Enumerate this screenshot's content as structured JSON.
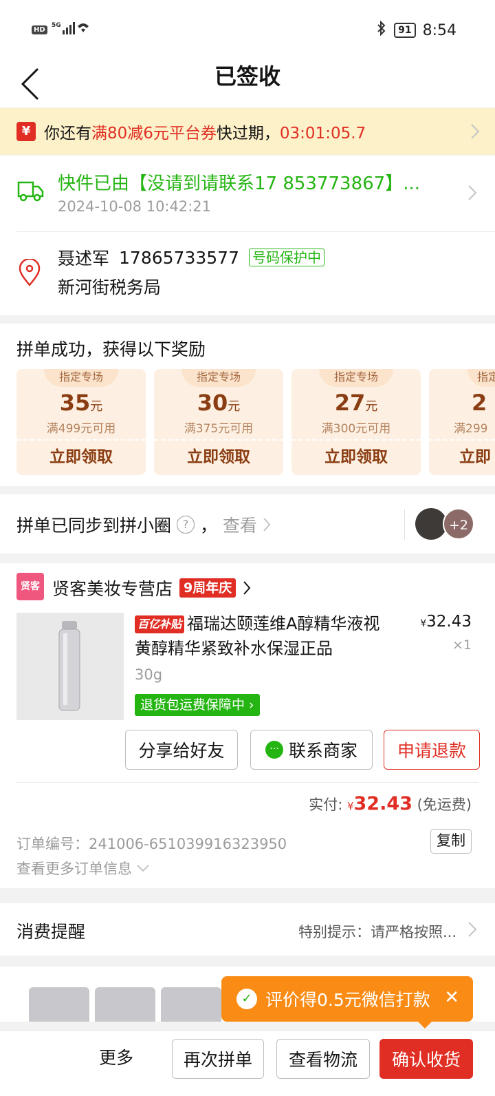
{
  "status_bar": {
    "hd": "HD",
    "signal": "5G",
    "battery": "91",
    "time": "8:54"
  },
  "header": {
    "title": "已签收"
  },
  "coupon_banner": {
    "prefix": "你还有",
    "highlight": "满80减6元平台券",
    "middle": "快过期，",
    "countdown": "03:01:05.7"
  },
  "logistics": {
    "status": "快件已由【没请到请联系17 853773867】...",
    "time": "2024-10-08 10:42:21"
  },
  "address": {
    "name": "聂述军",
    "phone": "17865733577",
    "badge": "号码保护中",
    "line": "新河街税务局"
  },
  "rewards": {
    "title": "拼单成功，获得以下奖励",
    "coupons": [
      {
        "tag": "指定专场",
        "amount": "35",
        "unit": "元",
        "condition": "满499元可用",
        "button": "立即领取"
      },
      {
        "tag": "指定专场",
        "amount": "30",
        "unit": "元",
        "condition": "满375元可用",
        "button": "立即领取"
      },
      {
        "tag": "指定专场",
        "amount": "27",
        "unit": "元",
        "condition": "满300元可用",
        "button": "立即领取"
      },
      {
        "tag": "指定",
        "amount": "2",
        "unit": "",
        "condition": "满299",
        "button": "立即"
      }
    ]
  },
  "group_sync": {
    "text": "拼单已同步到拼小圈",
    "help": "?",
    "comma": "，",
    "look": "查看",
    "more_count": "+2"
  },
  "order": {
    "shop_logo": "贤客",
    "shop_name": "贤客美妆专营店",
    "shop_badge": "9周年庆",
    "subsidy": "百亿补贴",
    "title": "福瑞达颐莲维A醇精华液视黄醇精华紧致补水保湿正品",
    "price_symbol": "¥",
    "price": "32.43",
    "qty": "×1",
    "spec": "30g",
    "guarantee": "退货包运费保障中",
    "buttons": {
      "share": "分享给好友",
      "contact": "联系商家",
      "refund": "申请退款"
    },
    "paid_label": "实付:",
    "paid_symbol": "¥",
    "paid_amount": "32.43",
    "shipping": "(免运费)",
    "order_no": "订单编号：241006-651039916323950",
    "copy": "复制",
    "more_info": "查看更多订单信息"
  },
  "reminder": {
    "label": "消费提醒",
    "text": "特别提示：请严格按照..."
  },
  "review_tip": {
    "text": "评价得0.5元微信打款"
  },
  "bottom_bar": {
    "more": "更多",
    "regroup": "再次拼单",
    "track": "查看物流",
    "confirm": "确认收货"
  },
  "colors": {
    "brand_red": "#e02e24",
    "green": "#25b513",
    "banner_bg": "#fdf1c9",
    "orange": "#fa8c16"
  }
}
